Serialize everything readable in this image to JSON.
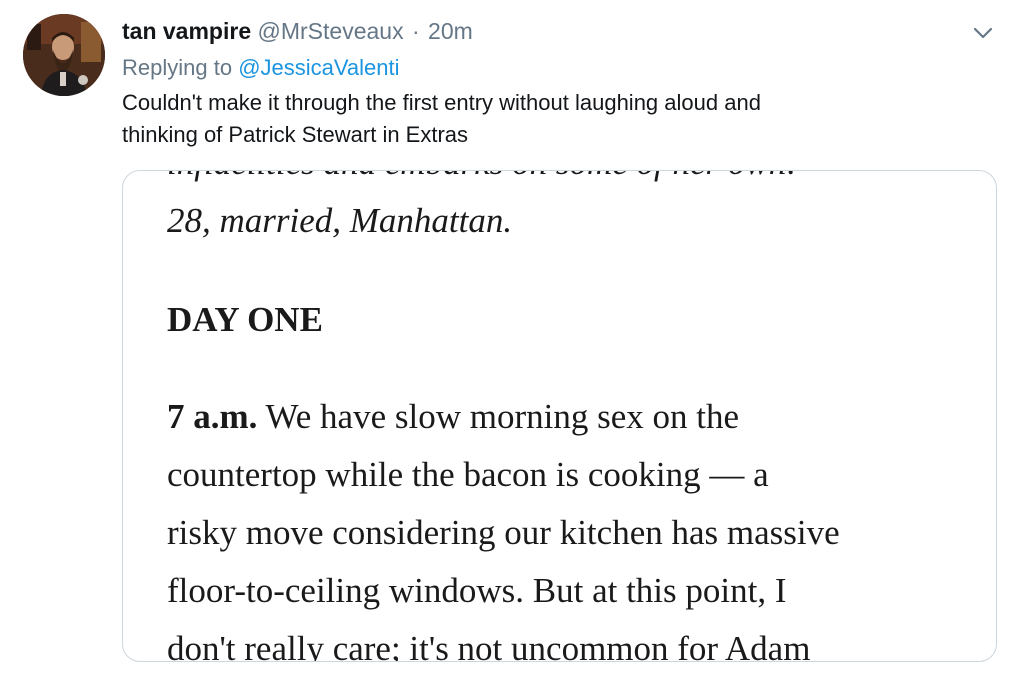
{
  "tweet": {
    "display_name": "tan vampire",
    "handle": "@MrSteveaux",
    "separator": "·",
    "time": "20m",
    "reply_prefix": "Replying to",
    "reply_mention": "@JessicaValenti",
    "text_line1": "Couldn't make it through the first entry without laughing aloud and",
    "text_line2": "thinking of Patrick Stewart in Extras",
    "avatar_icon": "user-avatar-photo",
    "menu_icon": "chevron-down-icon",
    "colors": {
      "name": "#14171a",
      "secondary": "#657786",
      "link": "#1b95e0",
      "border": "#ccd6dd"
    }
  },
  "media": {
    "intro_line1": "infidelities and embarks on some of her own:",
    "intro_line2": "28, married, Manhattan.",
    "heading": "DAY ONE",
    "entry_time": "7 a.m.",
    "entry_line1": " We have slow morning sex on the",
    "entry_line2": "countertop while the bacon is cooking — a",
    "entry_line3": "risky move considering our kitchen has massive",
    "entry_line4": "floor-to-ceiling windows. But at this point, I",
    "entry_line5": "don't really care; it's not uncommon for Adam"
  }
}
